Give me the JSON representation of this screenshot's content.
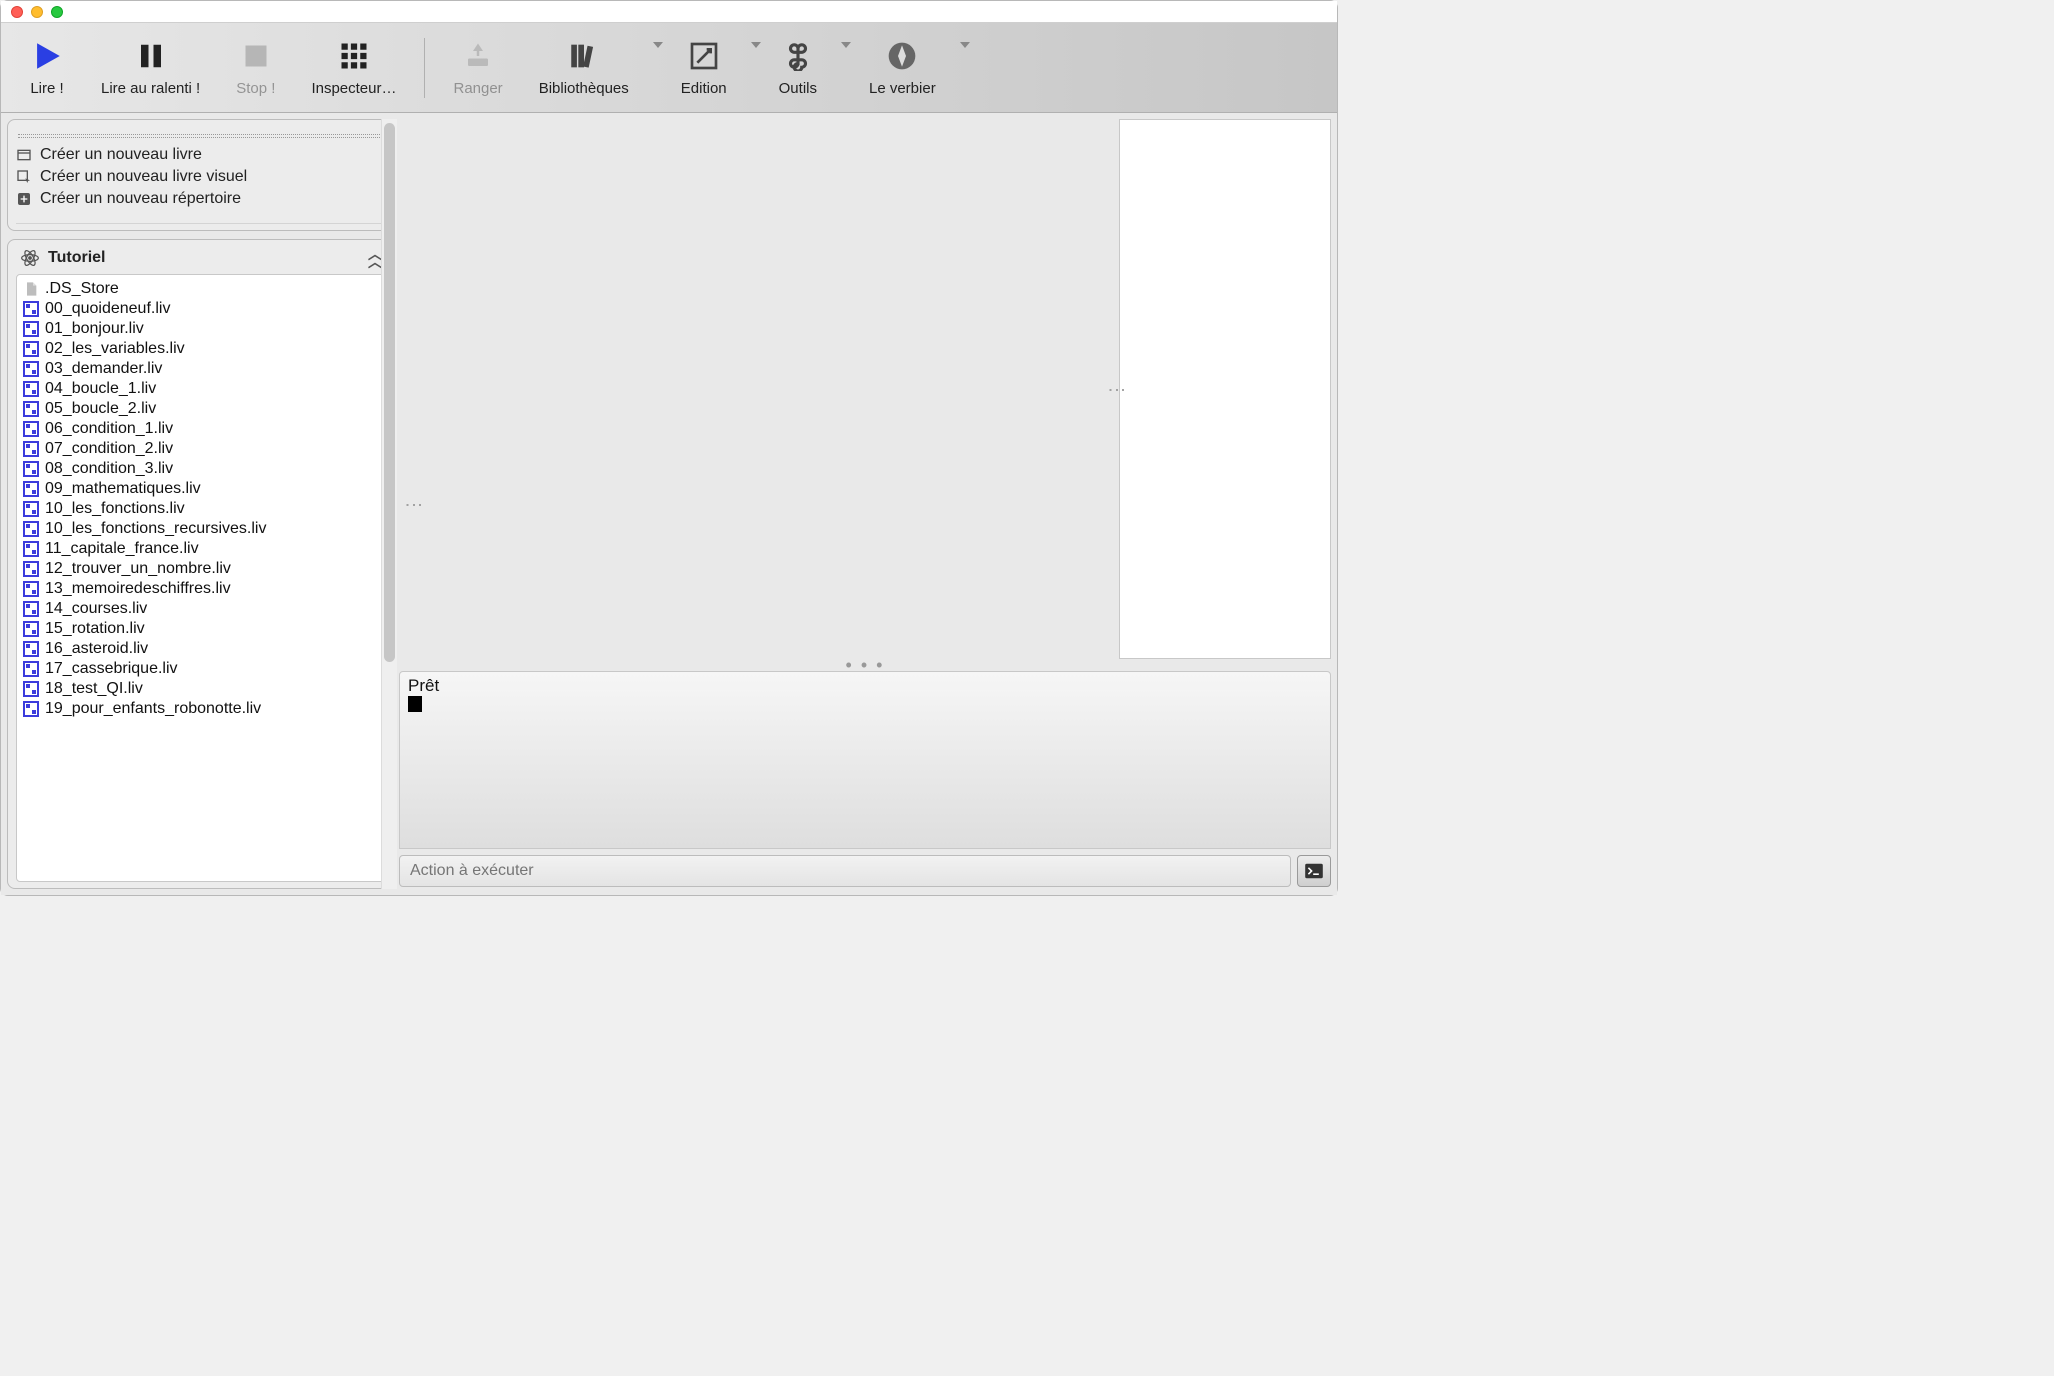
{
  "toolbar": {
    "lire": "Lire !",
    "lire_ralenti": "Lire au ralenti !",
    "stop": "Stop !",
    "inspecteur": "Inspecteur…",
    "ranger": "Ranger",
    "bibliotheques": "Bibliothèques",
    "edition": "Edition",
    "outils": "Outils",
    "le_verbier": "Le verbier"
  },
  "sidebar": {
    "create": {
      "new_book": "Créer un nouveau livre",
      "new_visual_book": "Créer un nouveau livre visuel",
      "new_dir": "Créer un nouveau répertoire"
    },
    "tutoriel_title": "Tutoriel",
    "files": [
      ".DS_Store",
      "00_quoideneuf.liv",
      "01_bonjour.liv",
      "02_les_variables.liv",
      "03_demander.liv",
      "04_boucle_1.liv",
      "05_boucle_2.liv",
      "06_condition_1.liv",
      "07_condition_2.liv",
      "08_condition_3.liv",
      "09_mathematiques.liv",
      "10_les_fonctions.liv",
      "10_les_fonctions_recursives.liv",
      "11_capitale_france.liv",
      "12_trouver_un_nombre.liv",
      "13_memoiredeschiffres.liv",
      "14_courses.liv",
      "15_rotation.liv",
      "16_asteroid.liv",
      "17_cassebrique.liv",
      "18_test_QI.liv",
      "19_pour_enfants_robonotte.liv"
    ]
  },
  "console": {
    "status": "Prêt"
  },
  "command": {
    "placeholder": "Action à exécuter"
  }
}
